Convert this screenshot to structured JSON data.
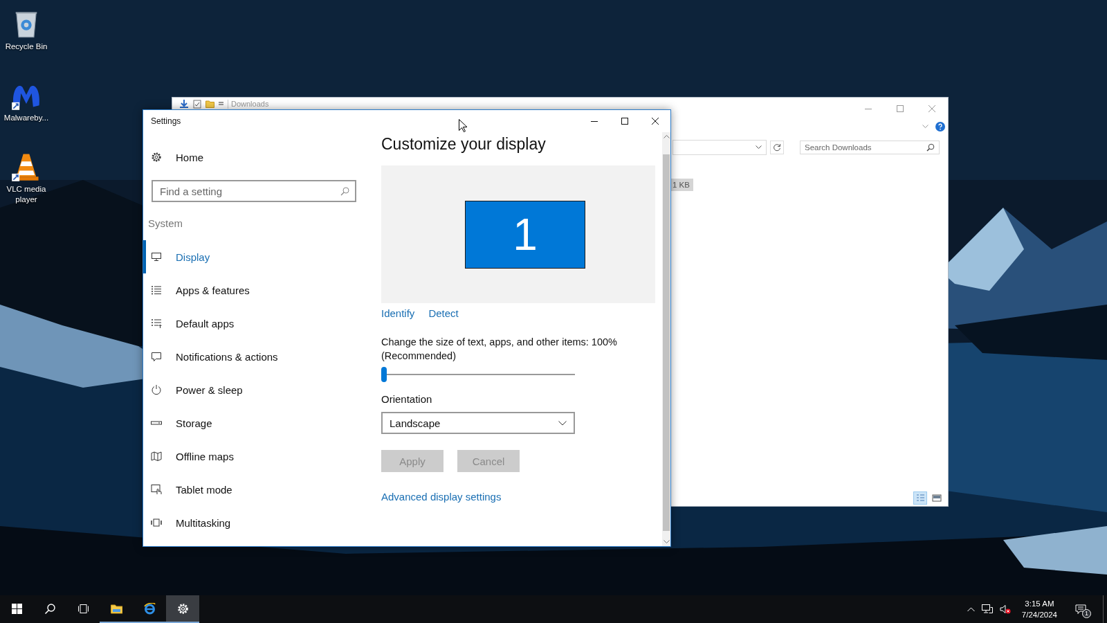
{
  "desktop_icons": [
    {
      "kind": "recycle-bin",
      "label": "Recycle Bin"
    },
    {
      "kind": "malwarebytes",
      "label": "Malwareby..."
    },
    {
      "kind": "vlc",
      "label": "VLC media player"
    }
  ],
  "explorer_window": {
    "title": "Downloads",
    "search": {
      "placeholder": "Search Downloads"
    },
    "file_rows": [
      {
        "size": "1 KB",
        "selected": true
      }
    ],
    "view_buttons": [
      {
        "kind": "details",
        "selected": true
      },
      {
        "kind": "large-icons",
        "selected": false
      }
    ]
  },
  "settings_window": {
    "title": "Settings",
    "home": "Home",
    "search": {
      "placeholder": "Find a setting"
    },
    "section": "System",
    "nav": [
      {
        "kind": "display",
        "label": "Display",
        "selected": true
      },
      {
        "kind": "apps",
        "label": "Apps & features",
        "selected": false
      },
      {
        "kind": "default-apps",
        "label": "Default apps",
        "selected": false
      },
      {
        "kind": "notifications",
        "label": "Notifications & actions",
        "selected": false
      },
      {
        "kind": "power",
        "label": "Power & sleep",
        "selected": false
      },
      {
        "kind": "storage",
        "label": "Storage",
        "selected": false
      },
      {
        "kind": "maps",
        "label": "Offline maps",
        "selected": false
      },
      {
        "kind": "tablet",
        "label": "Tablet mode",
        "selected": false
      },
      {
        "kind": "multitasking",
        "label": "Multitasking",
        "selected": false
      }
    ],
    "heading": "Customize your display",
    "monitor": "1",
    "links": [
      "Identify",
      "Detect"
    ],
    "scale": {
      "label": "Change the size of text, apps, and other items: 100% (Recommended)",
      "level": 0
    },
    "orientation": {
      "label": "Orientation",
      "value": "Landscape"
    },
    "buttons": [
      {
        "label": "Apply",
        "disabled": true
      },
      {
        "label": "Cancel",
        "disabled": true
      }
    ],
    "advanced_link": "Advanced display settings"
  },
  "taskbar": {
    "buttons": [
      {
        "kind": "start",
        "running": false,
        "active": false
      },
      {
        "kind": "search",
        "running": false,
        "active": false
      },
      {
        "kind": "task-view",
        "running": false,
        "active": false
      },
      {
        "kind": "file-explorer",
        "running": true,
        "active": false
      },
      {
        "kind": "browser",
        "running": true,
        "active": false
      },
      {
        "kind": "settings",
        "running": true,
        "active": true
      }
    ],
    "tray": {
      "volume_muted": true,
      "time": "3:15 AM",
      "date": "7/24/2024",
      "notification_count": "1"
    }
  }
}
